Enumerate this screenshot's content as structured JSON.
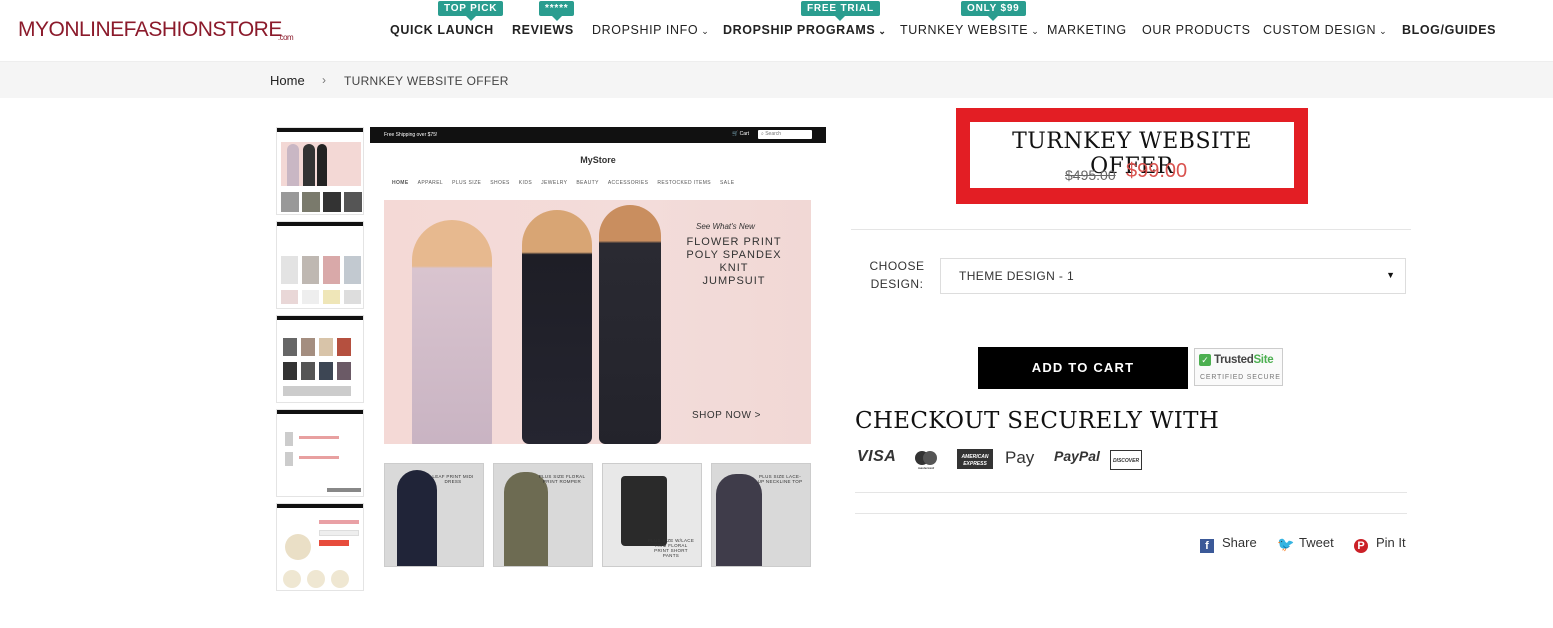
{
  "header": {
    "logo_text": "MYONLINEFASHIONSTORE",
    "logo_suffix": ".com",
    "nav": [
      {
        "label": "QUICK LAUNCH",
        "badge": "TOP PICK"
      },
      {
        "label": "REVIEWS",
        "badge": "*****"
      },
      {
        "label": "DROPSHIP INFO"
      },
      {
        "label": "DROPSHIP PROGRAMS",
        "badge": "FREE TRIAL"
      },
      {
        "label": "TURNKEY WEBSITE",
        "badge": "ONLY $99"
      },
      {
        "label": "MARKETING"
      },
      {
        "label": "OUR PRODUCTS"
      },
      {
        "label": "CUSTOM DESIGN"
      },
      {
        "label": "BLOG/GUIDES"
      }
    ]
  },
  "breadcrumb": {
    "home": "Home",
    "separator": "›",
    "current": "TURNKEY WEBSITE OFFER"
  },
  "preview": {
    "shipping_text": "Free Shipping over $75!",
    "cart_text": "Cart",
    "search_placeholder": "Search",
    "store_name": "MyStore",
    "nav": [
      "HOME",
      "APPAREL",
      "PLUS SIZE",
      "SHOES",
      "KIDS",
      "JEWELRY",
      "BEAUTY",
      "ACCESSORIES",
      "RESTOCKED ITEMS",
      "SALE"
    ],
    "hero_tag": "See What's New",
    "hero_line1": "FLOWER PRINT",
    "hero_line2": "POLY SPANDEX",
    "hero_line3": "KNIT",
    "hero_line4": "JUMPSUIT",
    "hero_cta": "SHOP NOW >",
    "tiles": [
      {
        "label": "LEAF PRINT MIDI DRESS"
      },
      {
        "label": "PLUS SIZE FLORAL PRINT ROMPER"
      },
      {
        "label": "PLUS SIZE W/LACE TRIM FLORAL PRINT SHORT PANTS"
      },
      {
        "label": "PLUS SIZE LACE-UP NECKLINE TOP"
      }
    ]
  },
  "product": {
    "title": "TURNKEY WEBSITE OFFER",
    "old_price": "$495.00",
    "price": "$99.00",
    "choose_label": "CHOOSE DESIGN:",
    "design_value": "THEME DESIGN - 1",
    "add_to_cart": "ADD TO CART",
    "trusted_prefix": "Trusted",
    "trusted_suffix": "Site",
    "trusted_sub": "CERTIFIED SECURE",
    "checkout_heading": "CHECKOUT SECURELY WITH",
    "payments": [
      "VISA",
      "mastercard",
      "AMERICAN EXPRESS",
      "Pay",
      "PayPal",
      "DISCOVER"
    ]
  },
  "social": {
    "share": "Share",
    "tweet": "Tweet",
    "pin": "Pin It"
  },
  "colors": {
    "brand": "#8b1a2b",
    "badge": "#2a9d8f",
    "offer_border": "#e31e24",
    "price": "#d9534f"
  }
}
